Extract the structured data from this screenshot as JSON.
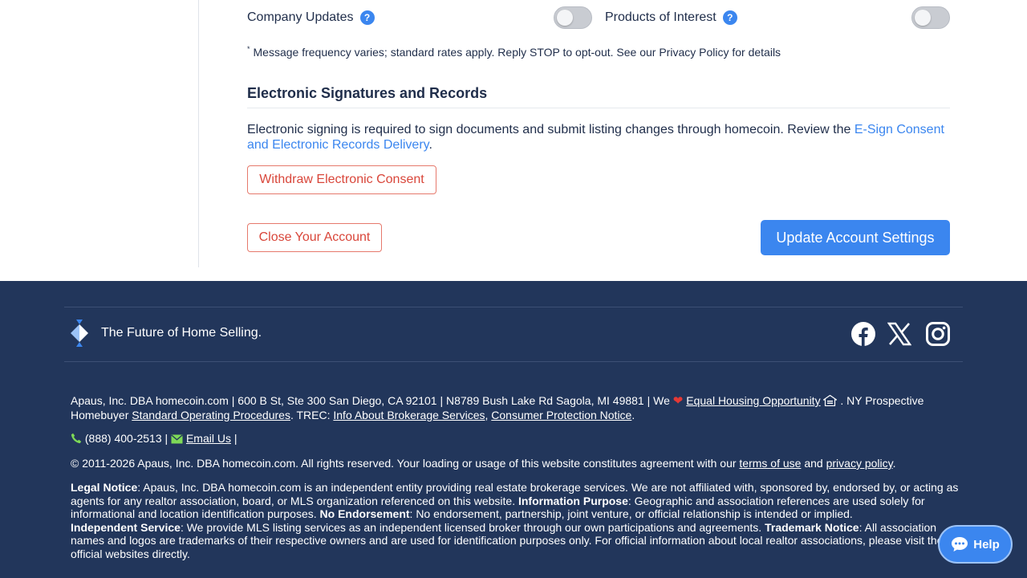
{
  "notifications": {
    "company_updates_label": "Company Updates",
    "products_of_interest_label": "Products of Interest",
    "help_glyph": "?",
    "company_updates_on": false,
    "products_of_interest_on": false,
    "sms_note_marker": "*",
    "sms_note": "Message frequency varies; standard rates apply. Reply STOP to opt-out. See our Privacy Policy for details"
  },
  "esign": {
    "title": "Electronic Signatures and Records",
    "text": "Electronic signing is required to sign documents and submit listing changes through homecoin. Review the ",
    "link_text": "E-Sign Consent and Electronic Records Delivery",
    "text_end": ".",
    "withdraw_label": "Withdraw Electronic Consent"
  },
  "account": {
    "close_label": "Close Your Account",
    "update_label": "Update Account Settings"
  },
  "footer": {
    "tagline": "The Future of Home Selling.",
    "social_icons": [
      "facebook-icon",
      "x-icon",
      "instagram-icon"
    ],
    "address_line": "Apaus, Inc. DBA homecoin.com | 600 B St, Ste 300 San Diego, CA 92101 | N8789 Bush Lake Rd Sagola, MI 49881 | We ",
    "equal_housing_link": "Equal Housing Opportunity",
    "ny_text": " . NY Prospective Homebuyer ",
    "sop_link": "Standard Operating Procedures",
    "trec_text": ". TREC: ",
    "brokerage_link": "Info About Brokerage Services",
    "comma": ", ",
    "consumer_link": "Consumer Protection Notice",
    "period": ".",
    "phone": "(888) 400-2513 | ",
    "email_link": "Email Us",
    "pipe": " |",
    "copyright_text": "© 2011-2026 Apaus, Inc. DBA homecoin.com. All rights reserved. Your loading or usage of this website constitutes agreement with our ",
    "terms_link": "terms of use",
    "and_text": " and ",
    "privacy_link": "privacy policy",
    "legal_notice_head": "Legal Notice",
    "legal_notice_text": ": Apaus, Inc. DBA homecoin.com is an independent entity providing real estate brokerage services. We are not affiliated with, sponsored by, endorsed by, or acting as agents for any realtor association, board, or MLS organization referenced on this website. ",
    "info_purpose_head": "Information Purpose",
    "info_purpose_text": ": Geographic and association references are used solely for informational and location identification purposes. ",
    "no_endorse_head": "No Endorsement",
    "no_endorse_text": ": No endorsement, partnership, joint venture, or official relationship is intended or implied. ",
    "indep_head": "Independent Service",
    "indep_text": ": We provide MLS listing services as an independent licensed broker through our own participations and agreements. ",
    "trademark_head": "Trademark Notice",
    "trademark_text": ": All association names and logos are trademarks of their respective owners and are used for identification purposes only. For official information about local realtor associations, please visit their official websites directly."
  },
  "chat": {
    "help_label": "Help"
  },
  "colors": {
    "accent": "#3b86ef",
    "danger": "#d9463a",
    "footer_bg": "#22365b"
  }
}
